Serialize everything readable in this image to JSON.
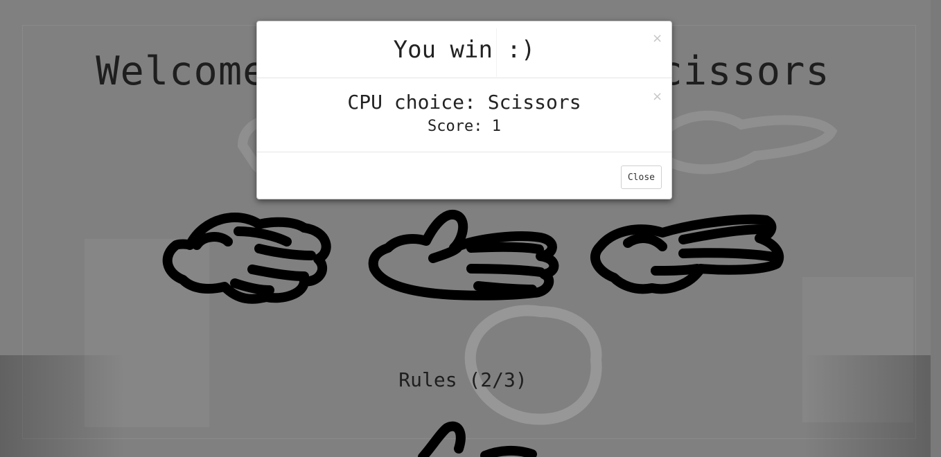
{
  "page": {
    "title": "Welcome to Rock Paper Scissors",
    "rules_heading": "Rules (2/3)"
  },
  "choices": [
    {
      "name": "Rock",
      "icon": "rock-hand-icon"
    },
    {
      "name": "Paper",
      "icon": "paper-hand-icon"
    },
    {
      "name": "Scissors",
      "icon": "scissors-hand-icon"
    }
  ],
  "modal": {
    "title": "You win :)",
    "cpu_choice": "CPU choice: Scissors",
    "score": "Score: 1",
    "close_label": "Close"
  },
  "colors": {
    "backdrop": "#808080",
    "modal_bg": "#ffffff",
    "text": "#222222"
  }
}
